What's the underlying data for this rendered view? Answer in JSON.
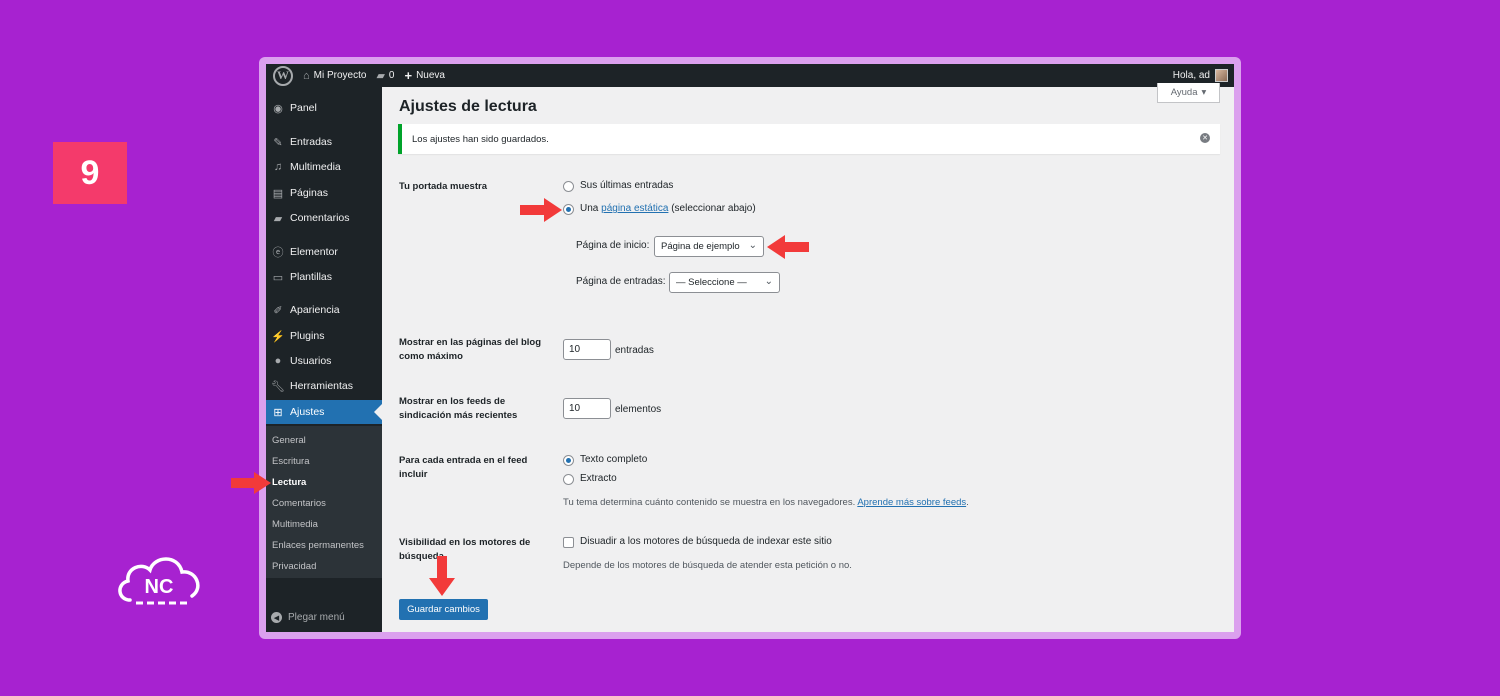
{
  "overlay": {
    "step_number": "9",
    "logo_text": "NC"
  },
  "adminbar": {
    "site_name": "Mi Proyecto",
    "comments_count": "0",
    "new_label": "Nueva",
    "greeting": "Hola, ad"
  },
  "sidebar": {
    "items": [
      {
        "label": "Panel",
        "icon": "dashboard-icon"
      },
      {
        "label": "Entradas",
        "icon": "pin-icon"
      },
      {
        "label": "Multimedia",
        "icon": "media-icon"
      },
      {
        "label": "Páginas",
        "icon": "pages-icon"
      },
      {
        "label": "Comentarios",
        "icon": "comments-icon"
      },
      {
        "label": "Elementor",
        "icon": "elementor-icon"
      },
      {
        "label": "Plantillas",
        "icon": "folder-icon"
      },
      {
        "label": "Apariencia",
        "icon": "brush-icon"
      },
      {
        "label": "Plugins",
        "icon": "plugin-icon"
      },
      {
        "label": "Usuarios",
        "icon": "users-icon"
      },
      {
        "label": "Herramientas",
        "icon": "wrench-icon"
      },
      {
        "label": "Ajustes",
        "icon": "settings-icon"
      }
    ],
    "submenu": [
      "General",
      "Escritura",
      "Lectura",
      "Comentarios",
      "Multimedia",
      "Enlaces permanentes",
      "Privacidad"
    ],
    "current_submenu": "Lectura",
    "collapse_label": "Plegar menú"
  },
  "page": {
    "help_label": "Ayuda",
    "title": "Ajustes de lectura",
    "notice": "Los ajustes han sido guardados.",
    "front_page": {
      "label": "Tu portada muestra",
      "option_latest": "Sus últimas entradas",
      "option_static_prefix": "Una",
      "option_static_link": "página estática",
      "option_static_suffix": "(seleccionar abajo)",
      "selected": "static",
      "homepage_label": "Página de inicio:",
      "homepage_value": "Página de ejemplo",
      "posts_page_label": "Página de entradas:",
      "posts_page_value": "— Seleccione —"
    },
    "blog_pages": {
      "label": "Mostrar en las páginas del blog como máximo",
      "value": "10",
      "unit": "entradas"
    },
    "feeds": {
      "label": "Mostrar en los feeds de sindicación más recientes",
      "value": "10",
      "unit": "elementos"
    },
    "feed_content": {
      "label": "Para cada entrada en el feed incluir",
      "option_full": "Texto completo",
      "option_excerpt": "Extracto",
      "selected": "full",
      "description": "Tu tema determina cuánto contenido se muestra en los navegadores.",
      "link": "Aprende más sobre feeds"
    },
    "visibility": {
      "label": "Visibilidad en los motores de búsqueda",
      "checkbox_label": "Disuadir a los motores de búsqueda de indexar este sitio",
      "checked": false,
      "description": "Depende de los motores de búsqueda de atender esta petición o no."
    },
    "save_label": "Guardar cambios"
  },
  "colors": {
    "background": "#a722d0",
    "badge": "#f43a6b",
    "arrow": "#f23a3a",
    "wp_blue": "#2271b1",
    "admin_dark": "#1d2327",
    "success": "#00a32a"
  }
}
